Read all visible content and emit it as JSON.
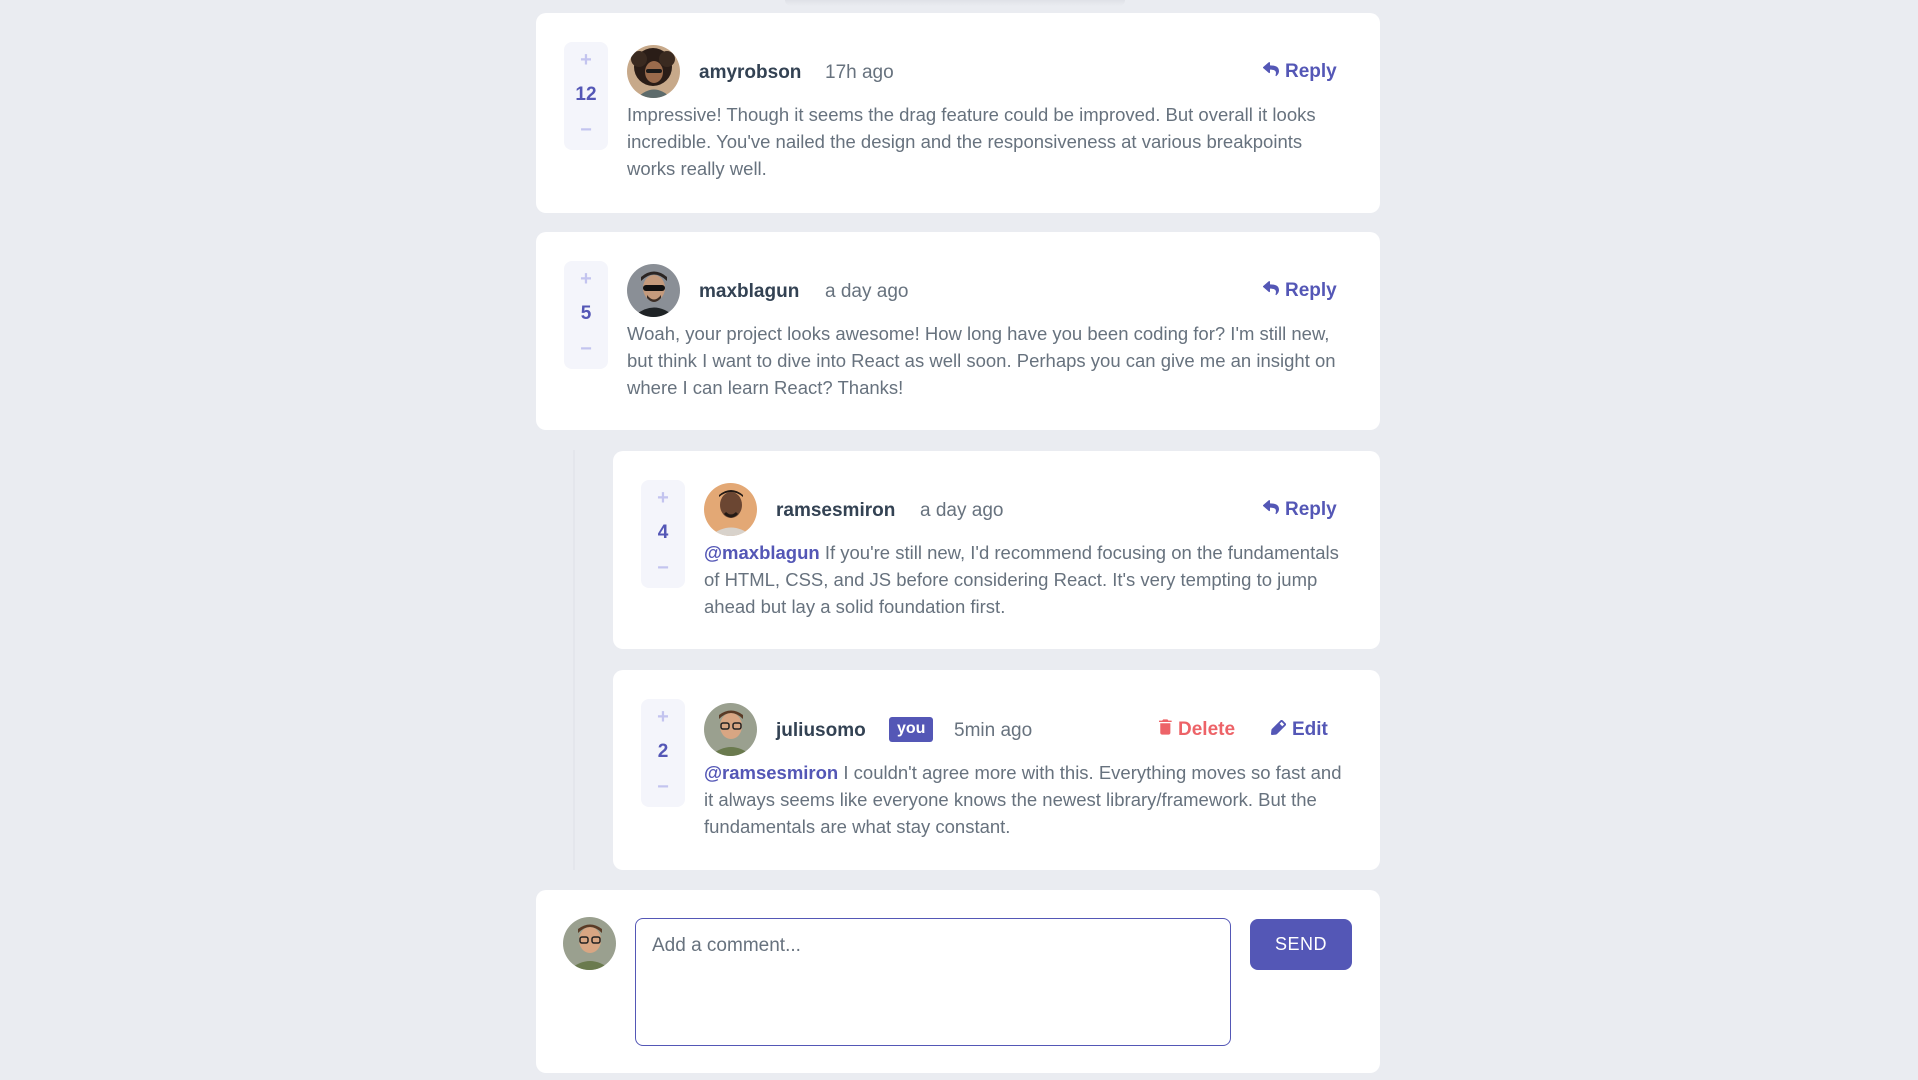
{
  "theme": {
    "accent": "#5457b6",
    "accent_light": "#c3c4ef",
    "danger": "#ed6368",
    "background": "#eaecf1",
    "card": "#ffffff",
    "heading": "#334253",
    "text": "#67727e"
  },
  "comments": [
    {
      "score": "12",
      "username": "amyrobson",
      "time": "17h ago",
      "text": "Impressive! Though it seems the drag feature could be improved. But overall it looks incredible. You've nailed the design and the responsiveness at various breakpoints works really well.",
      "reply_label": "Reply",
      "vote_up": "+",
      "vote_down": "−"
    },
    {
      "score": "5",
      "username": "maxblagun",
      "time": "a day ago",
      "text": "Woah, your project looks awesome! How long have you been coding for? I'm still new, but think I want to dive into React as well soon. Perhaps you can give me an insight on where I can learn React? Thanks!",
      "reply_label": "Reply",
      "vote_up": "+",
      "vote_down": "−"
    }
  ],
  "replies": [
    {
      "score": "4",
      "username": "ramsesmiron",
      "time": "a day ago",
      "mention": "@maxblagun",
      "text": "If you're still new, I'd recommend focusing on the fundamentals of HTML, CSS, and JS before considering React. It's very tempting to jump ahead but lay a solid foundation first.",
      "reply_label": "Reply",
      "vote_up": "+",
      "vote_down": "−"
    },
    {
      "score": "2",
      "username": "juliusomo",
      "badge": "you",
      "time": "5min ago",
      "mention": "@ramsesmiron",
      "text": "I couldn't agree more with this. Everything moves so fast and it always seems like everyone knows the newest library/framework. But the fundamentals are what stay constant.",
      "delete_label": "Delete",
      "edit_label": "Edit",
      "vote_up": "+",
      "vote_down": "−"
    }
  ],
  "new_comment": {
    "placeholder": "Add a comment...",
    "send_label": "SEND"
  },
  "icons": {
    "reply": "reply-arrow-icon",
    "delete": "trash-icon",
    "edit": "pencil-icon"
  }
}
